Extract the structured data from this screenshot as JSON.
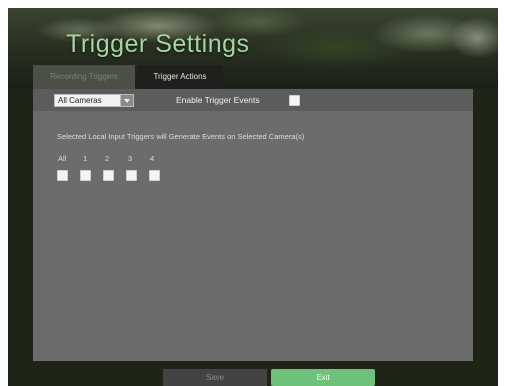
{
  "window": {
    "title": "Trigger Settings"
  },
  "tabs": [
    {
      "label": "Recording Triggers",
      "active": false
    },
    {
      "label": "Trigger Actions",
      "active": true
    }
  ],
  "toolbar": {
    "camera_select": {
      "value": "All Cameras"
    },
    "enable_label": "Enable Trigger Events",
    "enable_checked": false
  },
  "main": {
    "description": "Selected Local Input Triggers will Generate Events on Selected Camera(s)",
    "triggers": [
      {
        "label": "All",
        "checked": false
      },
      {
        "label": "1",
        "checked": false
      },
      {
        "label": "2",
        "checked": false
      },
      {
        "label": "3",
        "checked": false
      },
      {
        "label": "4",
        "checked": false
      }
    ]
  },
  "footer": {
    "save_label": "Save",
    "exit_label": "Exit"
  },
  "colors": {
    "title": "#a3d6a0",
    "exit_button": "#6ec17a",
    "panel": "#6c6c6c"
  },
  "icons": {
    "dropdown": "chevron-down-icon"
  }
}
